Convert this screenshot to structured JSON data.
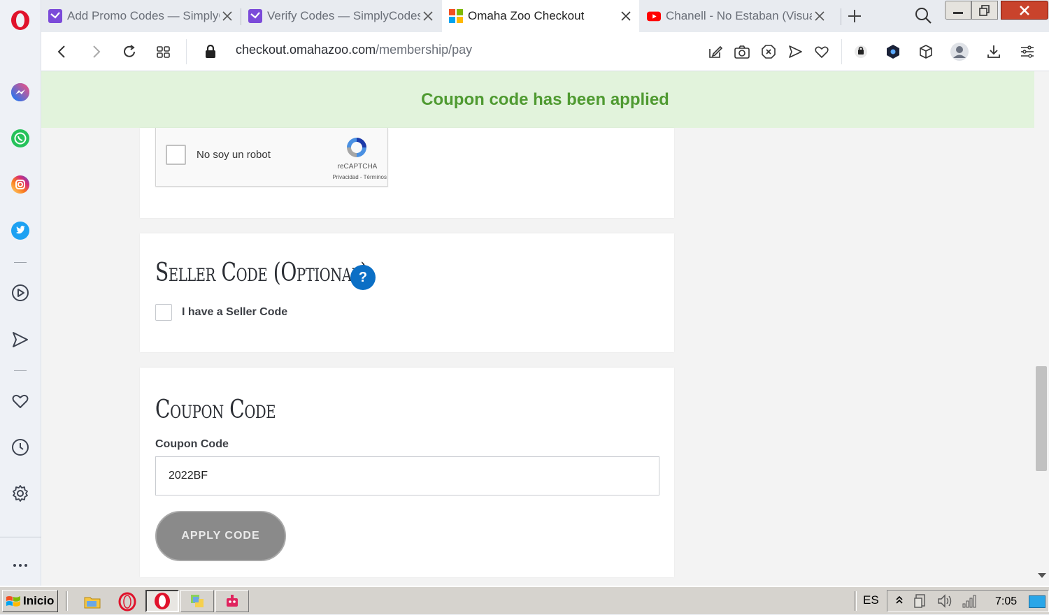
{
  "browser": {
    "tabs": [
      {
        "title": "Add Promo Codes — SimplyCodes",
        "favicon": "simplycodes-icon",
        "active": false
      },
      {
        "title": "Verify Codes — SimplyCodes",
        "favicon": "simplycodes-icon",
        "active": false
      },
      {
        "title": "Omaha Zoo Checkout",
        "favicon": "windows-logo-icon",
        "active": true
      },
      {
        "title": "Chanell - No Estaban (Visualizer)",
        "favicon": "youtube-icon",
        "active": false
      }
    ],
    "url_host": "checkout.omahazoo.com",
    "url_path": "/membership/pay"
  },
  "page": {
    "banner": "Coupon code has been applied",
    "recaptcha": {
      "label": "No soy un robot",
      "brand": "reCAPTCHA",
      "links": "Privacidad - Términos"
    },
    "seller": {
      "title": "Seller Code (Optional)",
      "help": "?",
      "checkbox_label": "I have a Seller Code"
    },
    "coupon": {
      "title": "Coupon Code",
      "field_label": "Coupon Code",
      "value": "2022BF",
      "button": "APPLY CODE"
    }
  },
  "taskbar": {
    "start": "Inicio",
    "lang": "ES",
    "clock": "7:05"
  },
  "colors": {
    "banner_bg": "#e2f3dc",
    "banner_text": "#4f9a31",
    "help_blue": "#0b6fc5",
    "button_gray": "#8a8a8a"
  }
}
